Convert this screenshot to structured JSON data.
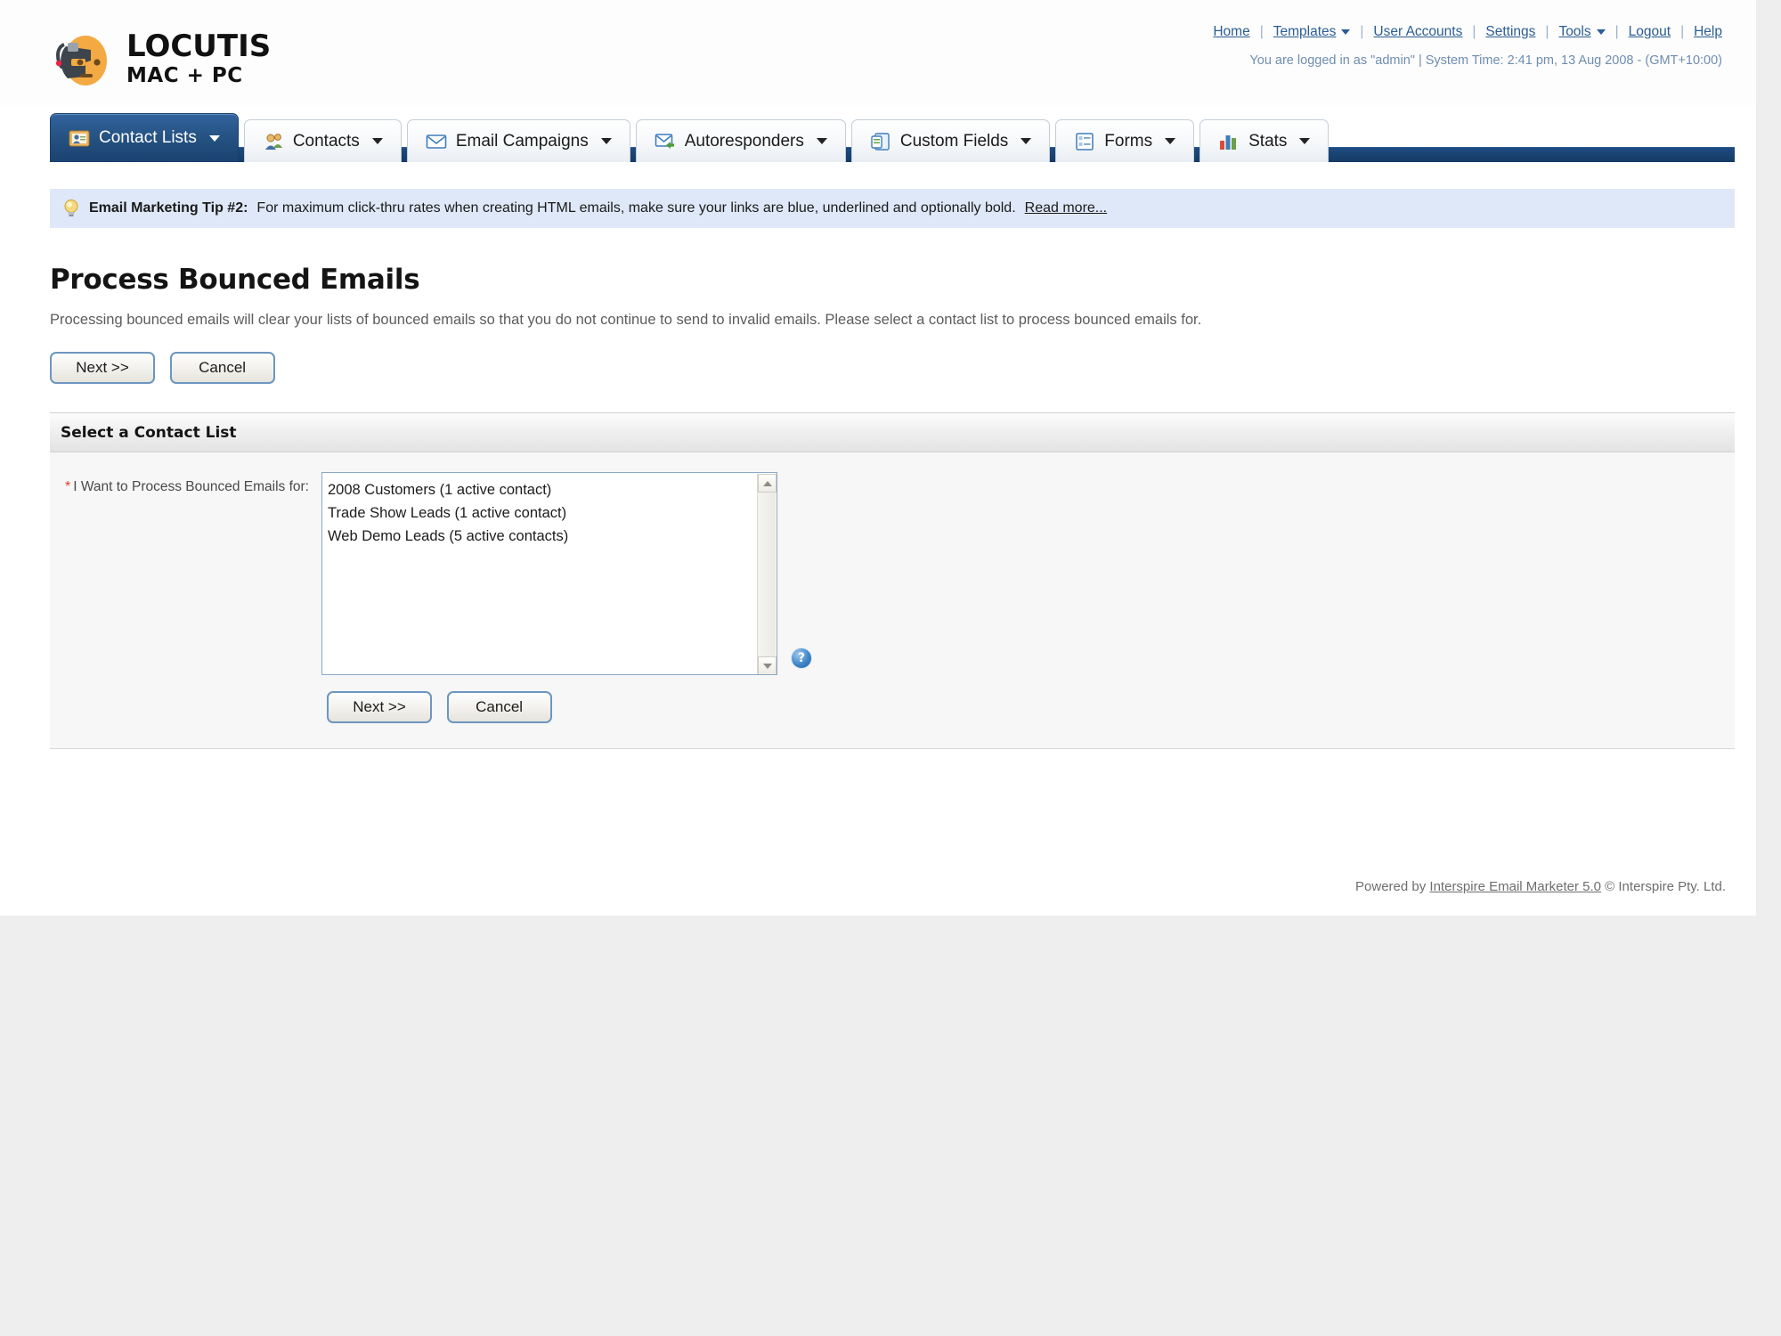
{
  "brand": {
    "name": "LOCUTIS",
    "tagline": "MAC + PC",
    "logo_icon": "robot-head-logo"
  },
  "topnav": {
    "links": [
      {
        "label": "Home",
        "icon": "",
        "has_caret": false
      },
      {
        "label": "Templates",
        "icon": "chevron-down-icon",
        "has_caret": true
      },
      {
        "label": "User Accounts",
        "icon": "",
        "has_caret": false
      },
      {
        "label": "Settings",
        "icon": "",
        "has_caret": false
      },
      {
        "label": "Tools",
        "icon": "chevron-down-icon",
        "has_caret": true
      },
      {
        "label": "Logout",
        "icon": "",
        "has_caret": false
      },
      {
        "label": "Help",
        "icon": "",
        "has_caret": false
      }
    ],
    "separator": "|",
    "status": "You are logged in as \"admin\" | System Time: 2:41 pm, 13 Aug 2008 - (GMT+10:00)"
  },
  "tabs": [
    {
      "label": "Contact Lists",
      "icon": "contact-lists-icon",
      "active": true,
      "has_caret": true
    },
    {
      "label": "Contacts",
      "icon": "contacts-icon",
      "active": false,
      "has_caret": true
    },
    {
      "label": "Email Campaigns",
      "icon": "envelope-icon",
      "active": false,
      "has_caret": true
    },
    {
      "label": "Autoresponders",
      "icon": "autoresponder-icon",
      "active": false,
      "has_caret": true
    },
    {
      "label": "Custom Fields",
      "icon": "custom-fields-icon",
      "active": false,
      "has_caret": true
    },
    {
      "label": "Forms",
      "icon": "forms-icon",
      "active": false,
      "has_caret": true
    },
    {
      "label": "Stats",
      "icon": "stats-bar-chart-icon",
      "active": false,
      "has_caret": true
    }
  ],
  "tip": {
    "icon": "lightbulb-icon",
    "label": "Email Marketing Tip #2:",
    "text": "For maximum click-thru rates when creating HTML emails, make sure your links are blue, underlined and optionally bold.",
    "link": "Read more..."
  },
  "page": {
    "title": "Process Bounced Emails",
    "description": "Processing bounced emails will clear your lists of bounced emails so that you do not continue to send to invalid emails. Please select a contact list to process bounced emails for."
  },
  "actions": {
    "next": "Next >>",
    "cancel": "Cancel"
  },
  "panel": {
    "header": "Select a Contact List",
    "field_label": "I Want to Process Bounced Emails for:",
    "required_marker": "*",
    "help_icon": "help-question-icon",
    "help_glyph": "?",
    "list_options": [
      "2008 Customers (1 active contact)",
      "Trade Show Leads (1 active contact)",
      "Web Demo Leads (5 active contacts)"
    ]
  },
  "footer": {
    "prefix": "Powered by",
    "link": "Interspire Email Marketer 5.0",
    "suffix": "© Interspire Pty. Ltd."
  },
  "colors": {
    "accent_blue": "#23507f",
    "link_blue": "#2b5d93",
    "tip_bg": "#dfe8f8",
    "required_red": "#e03a2f"
  }
}
